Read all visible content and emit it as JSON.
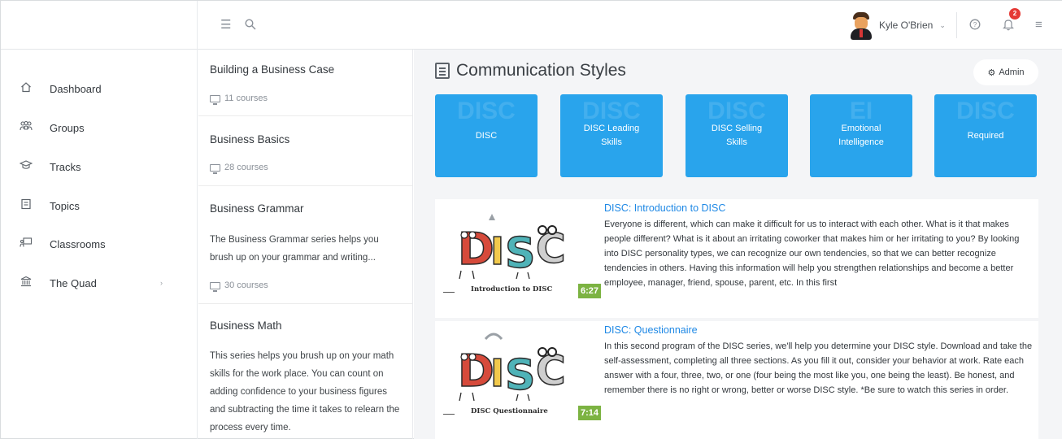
{
  "user": {
    "name": "Kyle O'Brien"
  },
  "notifications": {
    "count": "2"
  },
  "sidebar": {
    "items": [
      {
        "label": "Dashboard",
        "icon": "home-icon"
      },
      {
        "label": "Groups",
        "icon": "groups-icon"
      },
      {
        "label": "Tracks",
        "icon": "graduation-cap-icon"
      },
      {
        "label": "Topics",
        "icon": "topics-book-icon"
      },
      {
        "label": "Classrooms",
        "icon": "classroom-icon"
      },
      {
        "label": "The Quad",
        "icon": "bank-icon"
      }
    ]
  },
  "series_list": [
    {
      "title": "Building a Business Case",
      "count": "11 courses"
    },
    {
      "title": "Business Basics",
      "count": "28 courses"
    },
    {
      "title": "Business Grammar",
      "description": "The Business Grammar series helps you brush up on your grammar and writing...",
      "count": "30 courses"
    },
    {
      "title": "Business Math",
      "description": "This series helps you brush up on your math skills for the work place. You can count on adding confidence to your business figures and subtracting the time it takes to relearn the process every time."
    }
  ],
  "main": {
    "title": "Communication Styles",
    "admin_label": "Admin",
    "tiles": [
      {
        "label": "DISC",
        "ghost": "DISC"
      },
      {
        "label": "DISC Leading Skills",
        "ghost": "DISC"
      },
      {
        "label": "DISC Selling Skills",
        "ghost": "DISC"
      },
      {
        "label": "Emotional Intelligence",
        "ghost": "EI"
      },
      {
        "label": "Required",
        "ghost": "DISC"
      }
    ],
    "courses": [
      {
        "title": "DISC: Introduction to DISC",
        "description": "Everyone is different, which can make it difficult for us to interact with each other. What is it that makes people different? What is it about an irritating coworker that makes him or her irritating to you? By looking into DISC personality types, we can recognize our own tendencies, so that we can better recognize tendencies in others. Having this information will help you strengthen relationships and become a better employee, manager, friend, spouse, parent, etc. In this first",
        "duration": "6:27",
        "thumb_caption": "Introduction to DISC"
      },
      {
        "title": "DISC: Questionnaire",
        "description": "In this second program of the DISC series, we'll help you determine your DISC style. Download and take the self-assessment, completing all three sections. As you fill it out, consider your behavior at work. Rate each answer with a four, three, two, or one (four being the most like you, one being the least). Be honest, and remember there is no right or wrong, better or worse DISC style. *Be sure to watch this series in order.",
        "duration": "7:14",
        "thumb_caption": "DISC Questionnaire"
      }
    ]
  },
  "colors": {
    "tile": "#29a4ec",
    "link": "#1e88e5",
    "duration": "#7cb342",
    "badge": "#e53935"
  }
}
